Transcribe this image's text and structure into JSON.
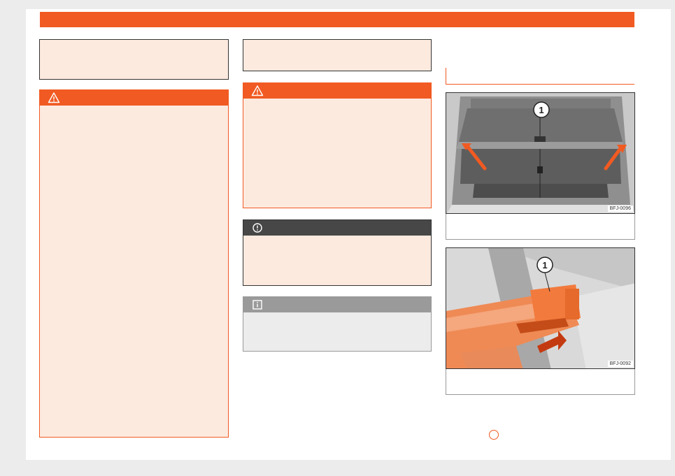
{
  "header": {
    "color": "#f15a22"
  },
  "column1": {
    "note_text": "",
    "warning_text": ""
  },
  "column2": {
    "note_text": "",
    "warning_text": "",
    "notice_text": "",
    "info_text": ""
  },
  "column3": {
    "section_title": "",
    "figure1": {
      "code": "BFJ-0096",
      "callout": "1",
      "caption": ""
    },
    "figure2": {
      "code": "BFJ-0092",
      "callout": "1",
      "caption": ""
    }
  },
  "icons": {
    "warning": "warning-triangle-icon",
    "notice": "exclamation-circle-icon",
    "info": "info-icon"
  },
  "colors": {
    "accent": "#f15a22",
    "warning_bg": "#fdeadf",
    "notice_head": "#474747",
    "info_head": "#9a9a9a"
  }
}
